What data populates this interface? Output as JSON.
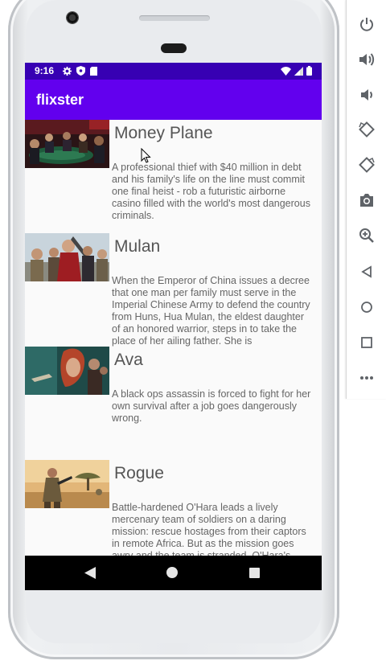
{
  "status_bar": {
    "time": "9:16"
  },
  "app_bar": {
    "title": "flixster"
  },
  "movies": [
    {
      "title": "Money Plane",
      "overview": "A professional thief with $40 million in debt and his family's life on the line must commit one final heist - rob a futuristic airborne casino filled with the world's most dangerous criminals."
    },
    {
      "title": "Mulan",
      "overview": "When the Emperor of China issues a decree that one man per family must serve in the Imperial Chinese Army to defend the country from Huns, Hua Mulan, the eldest daughter of an honored warrior, steps in to take the place of her ailing father. She is"
    },
    {
      "title": "Ava",
      "overview": "A black ops assassin is forced to fight for her own survival after a job goes dangerously wrong."
    },
    {
      "title": "Rogue",
      "overview": "Battle-hardened O'Hara leads a lively mercenary team of soldiers on a daring mission: rescue hostages from their captors in remote Africa. But as the mission goes awry and the team is stranded, O'Hara's"
    }
  ],
  "toolbar": {
    "items": [
      "power-icon",
      "volume-up-icon",
      "volume-down-icon",
      "rotate-left-icon",
      "rotate-right-icon",
      "camera-icon",
      "zoom-icon",
      "back-icon",
      "home-icon",
      "overview-icon",
      "more-icon"
    ]
  },
  "colors": {
    "primary": "#6200ee",
    "primary_dark": "#3700b3",
    "nav_bar": "#000000"
  }
}
